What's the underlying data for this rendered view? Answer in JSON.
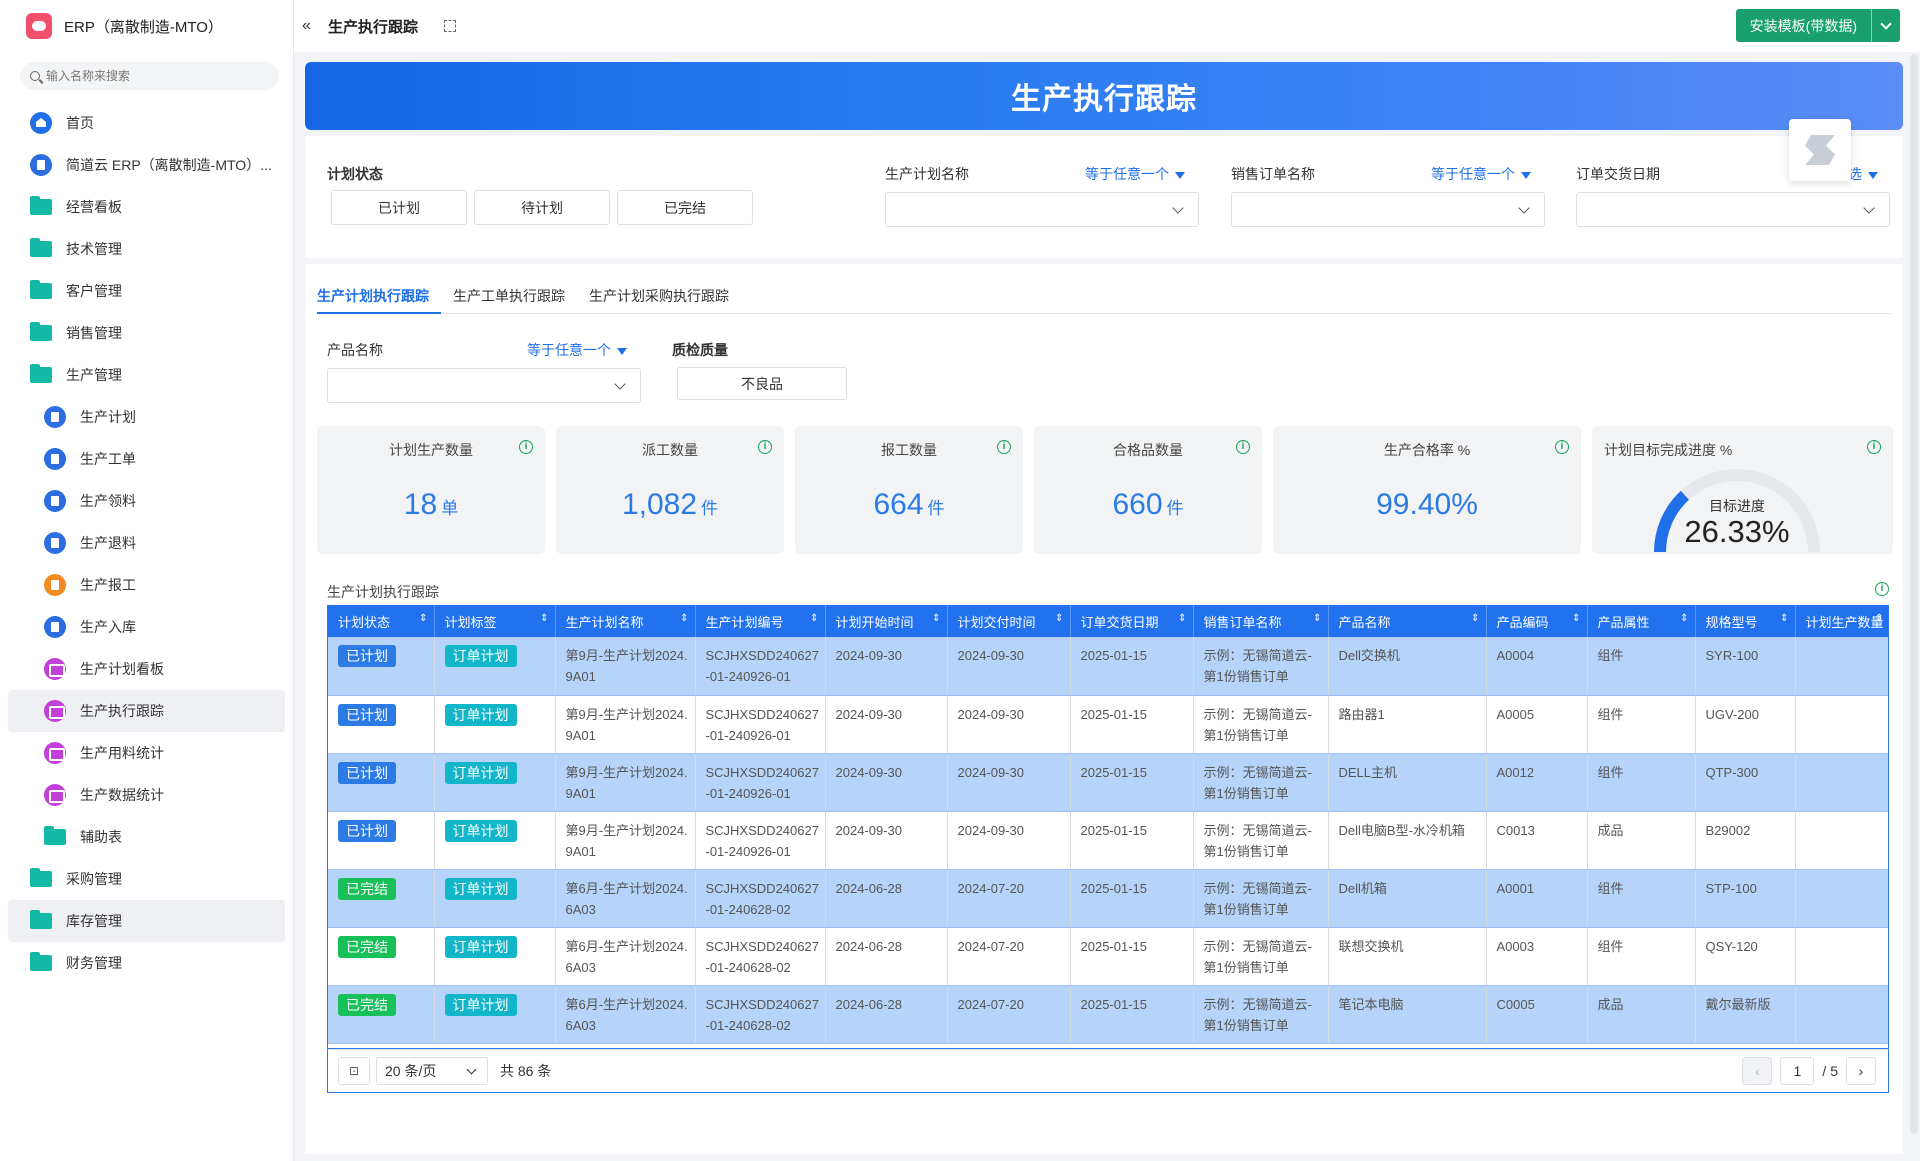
{
  "app": {
    "title": "ERP（离散制造-MTO）",
    "search_placeholder": "输入名称来搜索"
  },
  "sidebar": {
    "items": [
      {
        "label": "首页",
        "icon": "home-icon",
        "level": 0
      },
      {
        "label": "简道云 ERP（离散制造-MTO）...",
        "icon": "document-icon",
        "level": 0
      },
      {
        "label": "经营看板",
        "icon": "folder-icon",
        "level": 0
      },
      {
        "label": "技术管理",
        "icon": "folder-icon",
        "level": 0
      },
      {
        "label": "客户管理",
        "icon": "folder-icon",
        "level": 0
      },
      {
        "label": "销售管理",
        "icon": "folder-icon",
        "level": 0
      },
      {
        "label": "生产管理",
        "icon": "folder-open-icon",
        "level": 0
      },
      {
        "label": "生产计划",
        "icon": "form-icon",
        "level": 1
      },
      {
        "label": "生产工单",
        "icon": "form-icon",
        "level": 1
      },
      {
        "label": "生产领料",
        "icon": "form-icon",
        "level": 1
      },
      {
        "label": "生产退料",
        "icon": "form-icon",
        "level": 1
      },
      {
        "label": "生产报工",
        "icon": "form-orange-icon",
        "level": 1
      },
      {
        "label": "生产入库",
        "icon": "form-icon",
        "level": 1
      },
      {
        "label": "生产计划看板",
        "icon": "dashboard-icon",
        "level": 1
      },
      {
        "label": "生产执行跟踪",
        "icon": "dashboard-icon",
        "level": 1,
        "active": true
      },
      {
        "label": "生产用料统计",
        "icon": "dashboard-icon",
        "level": 1
      },
      {
        "label": "生产数据统计",
        "icon": "dashboard-icon",
        "level": 1
      },
      {
        "label": "辅助表",
        "icon": "folder-icon",
        "level": 1
      },
      {
        "label": "采购管理",
        "icon": "folder-icon",
        "level": 0
      },
      {
        "label": "库存管理",
        "icon": "folder-icon",
        "level": 0,
        "hover": true
      },
      {
        "label": "财务管理",
        "icon": "folder-icon",
        "level": 0
      }
    ]
  },
  "topbar": {
    "title": "生产执行跟踪",
    "install_label": "安装模板(带数据)"
  },
  "banner": {
    "title": "生产执行跟踪"
  },
  "filters": {
    "plan_status": {
      "label": "计划状态",
      "options": [
        "已计划",
        "待计划",
        "已完结"
      ]
    },
    "plan_name": {
      "label": "生产计划名称",
      "op": "等于任意一个"
    },
    "order_name": {
      "label": "销售订单名称",
      "op": "等于任意一个"
    },
    "delivery_date": {
      "label": "订单交货日期",
      "op": "选"
    }
  },
  "tabs": [
    "生产计划执行跟踪",
    "生产工单执行跟踪",
    "生产计划采购执行跟踪"
  ],
  "sub_filters": {
    "product_name": {
      "label": "产品名称",
      "op": "等于任意一个"
    },
    "quality": {
      "label": "质检质量",
      "option": "不良品"
    }
  },
  "kpis": [
    {
      "label": "计划生产数量",
      "value": "18",
      "unit": "单"
    },
    {
      "label": "派工数量",
      "value": "1,082",
      "unit": "件"
    },
    {
      "label": "报工数量",
      "value": "664",
      "unit": "件"
    },
    {
      "label": "合格品数量",
      "value": "660",
      "unit": "件"
    },
    {
      "label": "生产合格率 %",
      "value": "99.40%",
      "unit": ""
    },
    {
      "label": "计划目标完成进度 %",
      "gauge_title": "目标进度",
      "value": "26.33%",
      "progress": 0.2633
    }
  ],
  "table": {
    "title": "生产计划执行跟踪",
    "columns": [
      "计划状态",
      "计划标签",
      "生产计划名称",
      "生产计划编号",
      "计划开始时间",
      "计划交付时间",
      "订单交货日期",
      "销售订单名称",
      "产品名称",
      "产品编码",
      "产品属性",
      "规格型号",
      "计划生产数量"
    ],
    "rows": [
      [
        "已计划",
        "订单计划",
        "第9月-生产计划2024.9A01",
        "SCJHXSDD240627-01-240926-01",
        "2024-09-30",
        "2024-09-30",
        "2025-01-15",
        "示例：无锡简道云-第1份销售订单",
        "Dell交换机",
        "A0004",
        "组件",
        "SYR-100",
        ""
      ],
      [
        "已计划",
        "订单计划",
        "第9月-生产计划2024.9A01",
        "SCJHXSDD240627-01-240926-01",
        "2024-09-30",
        "2024-09-30",
        "2025-01-15",
        "示例：无锡简道云-第1份销售订单",
        "路由器1",
        "A0005",
        "组件",
        "UGV-200",
        ""
      ],
      [
        "已计划",
        "订单计划",
        "第9月-生产计划2024.9A01",
        "SCJHXSDD240627-01-240926-01",
        "2024-09-30",
        "2024-09-30",
        "2025-01-15",
        "示例：无锡简道云-第1份销售订单",
        "DELL主机",
        "A0012",
        "组件",
        "QTP-300",
        ""
      ],
      [
        "已计划",
        "订单计划",
        "第9月-生产计划2024.9A01",
        "SCJHXSDD240627-01-240926-01",
        "2024-09-30",
        "2024-09-30",
        "2025-01-15",
        "示例：无锡简道云-第1份销售订单",
        "Dell电脑B型-水冷机箱",
        "C0013",
        "成品",
        "B29002",
        ""
      ],
      [
        "已完结",
        "订单计划",
        "第6月-生产计划2024.6A03",
        "SCJHXSDD240627-01-240628-02",
        "2024-06-28",
        "2024-07-20",
        "2025-01-15",
        "示例：无锡简道云-第1份销售订单",
        "Dell机箱",
        "A0001",
        "组件",
        "STP-100",
        ""
      ],
      [
        "已完结",
        "订单计划",
        "第6月-生产计划2024.6A03",
        "SCJHXSDD240627-01-240628-02",
        "2024-06-28",
        "2024-07-20",
        "2025-01-15",
        "示例：无锡简道云-第1份销售订单",
        "联想交换机",
        "A0003",
        "组件",
        "QSY-120",
        ""
      ],
      [
        "已完结",
        "订单计划",
        "第6月-生产计划2024.6A03",
        "SCJHXSDD240627-01-240628-02",
        "2024-06-28",
        "2024-07-20",
        "2025-01-15",
        "示例：无锡简道云-第1份销售订单",
        "笔记本电脑",
        "C0005",
        "成品",
        "戴尔最新版",
        ""
      ]
    ]
  },
  "pager": {
    "page_size": "20 条/页",
    "total": "共 86 条",
    "current": "1",
    "pages": "/ 5"
  },
  "colors": {
    "accent": "#1e6fe8",
    "banner": "#2a7cf0",
    "install_button": "#19a06e",
    "row_highlight": "#b6d4fa"
  }
}
